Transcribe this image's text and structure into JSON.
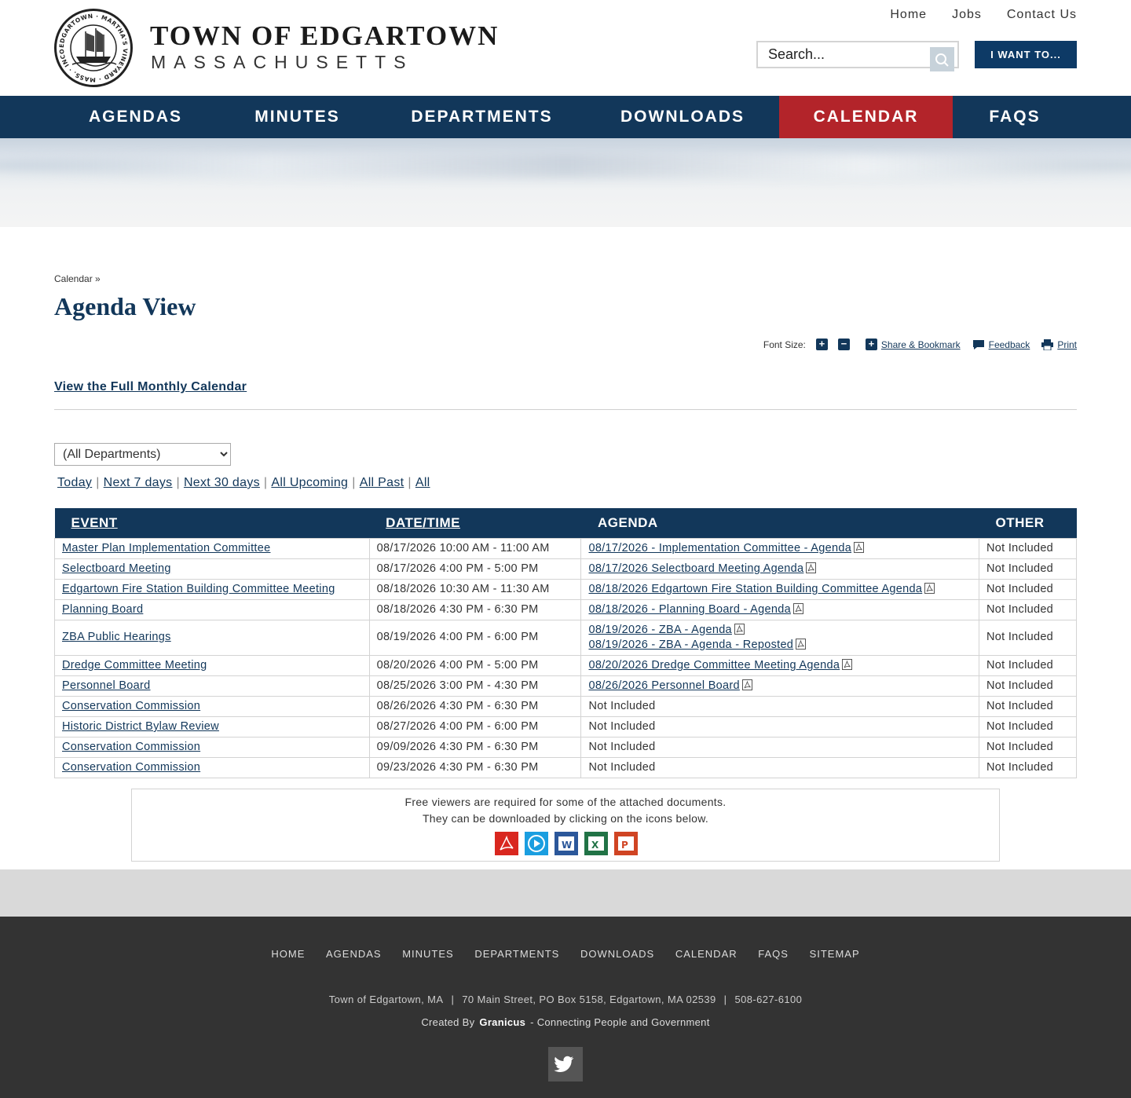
{
  "header": {
    "title": "TOWN OF EDGARTOWN",
    "subtitle": "MASSACHUSETTS",
    "seal_text": "EDGARTOWN MARTHA'S VINEYARD MASS. INCORPORATED 1671",
    "top_links": [
      "Home",
      "Jobs",
      "Contact Us"
    ],
    "search_placeholder": "Search...",
    "want_button": "I WANT TO..."
  },
  "nav": {
    "items": [
      "AGENDAS",
      "MINUTES",
      "DEPARTMENTS",
      "DOWNLOADS",
      "CALENDAR",
      "FAQS"
    ],
    "active": "CALENDAR",
    "active_color": "#b3242a",
    "bar_color": "#12375a"
  },
  "content": {
    "breadcrumb": "Calendar »",
    "title": "Agenda View",
    "font_size_label": "Font Size:",
    "share_label": "Share & Bookmark",
    "feedback_label": "Feedback",
    "print_label": "Print",
    "full_calendar_link": "View the Full Monthly Calendar",
    "department_select": "(All Departments)",
    "filters": [
      "Today",
      "Next 7 days",
      "Next 30 days",
      "All Upcoming",
      "All Past",
      "All"
    ]
  },
  "table": {
    "headers": [
      "EVENT",
      "DATE/TIME",
      "AGENDA",
      "OTHER"
    ],
    "rows": [
      {
        "event": "Master Plan Implementation Committee",
        "datetime": "08/17/2026 10:00 AM - 11:00 AM",
        "agenda": [
          "08/17/2026 - Implementation Committee - Agenda"
        ],
        "other": "Not Included"
      },
      {
        "event": "Selectboard Meeting",
        "datetime": "08/17/2026 4:00 PM - 5:00 PM",
        "agenda": [
          "08/17/2026 Selectboard Meeting Agenda"
        ],
        "other": "Not Included"
      },
      {
        "event": "Edgartown Fire Station Building Committee Meeting",
        "datetime": "08/18/2026 10:30 AM - 11:30 AM",
        "agenda": [
          "08/18/2026 Edgartown Fire Station Building Committee Agenda"
        ],
        "other": "Not Included"
      },
      {
        "event": "Planning Board",
        "datetime": "08/18/2026 4:30 PM - 6:30 PM",
        "agenda": [
          "08/18/2026 - Planning Board - Agenda"
        ],
        "other": "Not Included"
      },
      {
        "event": "ZBA Public Hearings",
        "datetime": "08/19/2026 4:00 PM - 6:00 PM",
        "agenda": [
          "08/19/2026 - ZBA - Agenda",
          "08/19/2026 - ZBA - Agenda - Reposted"
        ],
        "other": "Not Included"
      },
      {
        "event": "Dredge Committee Meeting",
        "datetime": "08/20/2026 4:00 PM - 5:00 PM",
        "agenda": [
          "08/20/2026 Dredge Committee Meeting Agenda"
        ],
        "other": "Not Included"
      },
      {
        "event": "Personnel Board",
        "datetime": "08/25/2026 3:00 PM - 4:30 PM",
        "agenda": [
          "08/26/2026 Personnel Board"
        ],
        "other": "Not Included"
      },
      {
        "event": "Conservation Commission",
        "datetime": "08/26/2026 4:30 PM - 6:30 PM",
        "agenda_text": "Not Included",
        "other": "Not Included"
      },
      {
        "event": "Historic District Bylaw Review",
        "datetime": "08/27/2026 4:00 PM - 6:00 PM",
        "agenda_text": "Not Included",
        "other": "Not Included"
      },
      {
        "event": "Conservation Commission",
        "datetime": "09/09/2026 4:30 PM - 6:30 PM",
        "agenda_text": "Not Included",
        "other": "Not Included"
      },
      {
        "event": "Conservation Commission",
        "datetime": "09/23/2026 4:30 PM - 6:30 PM",
        "agenda_text": "Not Included",
        "other": "Not Included"
      }
    ]
  },
  "viewers": {
    "line1": "Free viewers are required for some of the attached documents.",
    "line2": "They can be downloaded by clicking on the icons below.",
    "icons": [
      "pdf-viewer-icon",
      "media-player-icon",
      "word-viewer-icon",
      "excel-viewer-icon",
      "powerpoint-viewer-icon"
    ]
  },
  "footer": {
    "nav": [
      "HOME",
      "AGENDAS",
      "MINUTES",
      "DEPARTMENTS",
      "DOWNLOADS",
      "CALENDAR",
      "FAQS",
      "SITEMAP"
    ],
    "address": [
      "Town of Edgartown, MA",
      "70 Main Street, PO Box 5158, Edgartown, MA 02539",
      "508-627-6100"
    ],
    "credit_prefix": "Created By",
    "credit_brand": "Granicus",
    "credit_suffix": "- Connecting People and Government",
    "social": "twitter-icon"
  }
}
